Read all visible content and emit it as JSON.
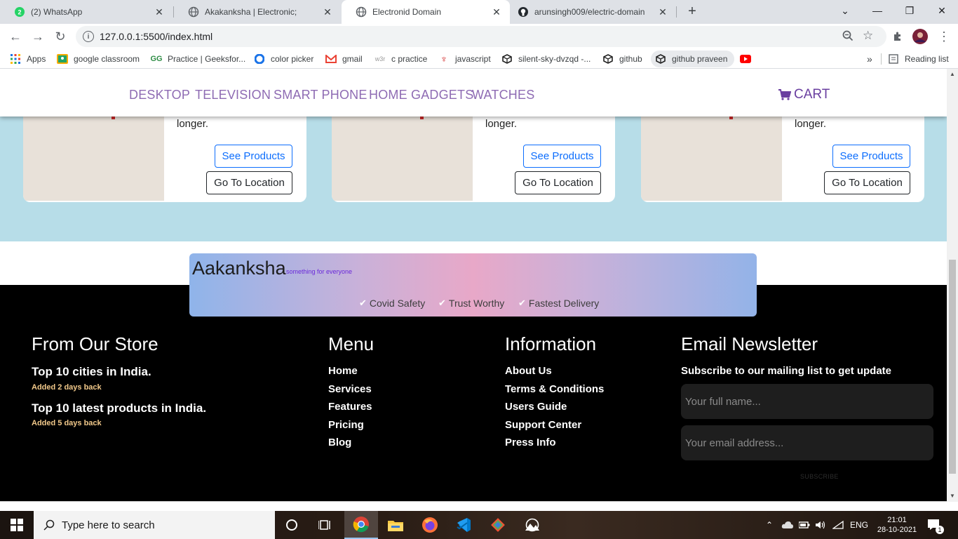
{
  "browser": {
    "tabs": [
      {
        "label": "(2) WhatsApp",
        "icon": "whatsapp-icon"
      },
      {
        "label": "Akakanksha | Electronic;",
        "icon": "globe-icon"
      },
      {
        "label": "Electronid Domain",
        "icon": "globe-icon",
        "active": true
      },
      {
        "label": "arunsingh009/electric-domain",
        "icon": "github-icon"
      }
    ],
    "url": "127.0.0.1:5500/index.html",
    "bookmarks": [
      {
        "label": "Apps",
        "icon": "apps-grid-icon"
      },
      {
        "label": "google classroom",
        "icon": "classroom-icon"
      },
      {
        "label": "Practice | Geeksfor...",
        "icon": "geeksforgeeks-icon"
      },
      {
        "label": "color picker",
        "icon": "color-picker-icon"
      },
      {
        "label": "gmail",
        "icon": "gmail-icon"
      },
      {
        "label": "c practice",
        "icon": "w3schools-icon"
      },
      {
        "label": "javascript",
        "icon": "javascript-icon"
      },
      {
        "label": "silent-sky-dvzqd -...",
        "icon": "codesandbox-icon"
      },
      {
        "label": "github",
        "icon": "codesandbox-icon"
      },
      {
        "label": "github praveen",
        "icon": "codesandbox-icon"
      }
    ],
    "bookmarks_overflow": "»",
    "reading_list": "Reading list"
  },
  "navbar": {
    "links": [
      "DESKTOP",
      "TELEVISION",
      "SMART PHONE",
      "HOME GADGETS",
      "WATCHES"
    ],
    "cart_label": "CART"
  },
  "cards": [
    {
      "text": "longer.",
      "see_label": "See Products",
      "go_label": "Go To Location"
    },
    {
      "text": "longer.",
      "see_label": "See Products",
      "go_label": "Go To Location"
    },
    {
      "text": "longer.",
      "see_label": "See Products",
      "go_label": "Go To Location"
    }
  ],
  "brand": {
    "name": "Aakanksha",
    "tagline": "something for everyone",
    "features": [
      "Covid Safety",
      "Trust Worthy",
      "Fastest Delivery"
    ]
  },
  "footer": {
    "store": {
      "title": "From Our Store",
      "items": [
        {
          "title": "Top 10 cities in India.",
          "sub": "Added 2 days back"
        },
        {
          "title": "Top 10 latest products in India.",
          "sub": "Added 5 days back"
        }
      ]
    },
    "menu": {
      "title": "Menu",
      "items": [
        "Home",
        "Services",
        "Features",
        "Pricing",
        "Blog"
      ]
    },
    "information": {
      "title": "Information",
      "items": [
        "About Us",
        "Terms & Conditions",
        "Users Guide",
        "Support Center",
        "Press Info"
      ]
    },
    "newsletter": {
      "title": "Email Newsletter",
      "subtitle": "Subscribe to our mailing list to get update",
      "name_placeholder": "Your full name...",
      "email_placeholder": "Your email address...",
      "subscribe_label": "SUBSCRIBE"
    }
  },
  "taskbar": {
    "search_placeholder": "Type here to search",
    "language": "ENG",
    "time": "21:01",
    "date": "28-10-2021",
    "notification_count": "1"
  },
  "colors": {
    "nav_link": "#8e6bb3",
    "cart": "#6a3fa0",
    "band": "#b7dde8",
    "primary_button": "#0d6efd",
    "footer_bg": "#000000",
    "footer_sub": "#f2c98a"
  }
}
